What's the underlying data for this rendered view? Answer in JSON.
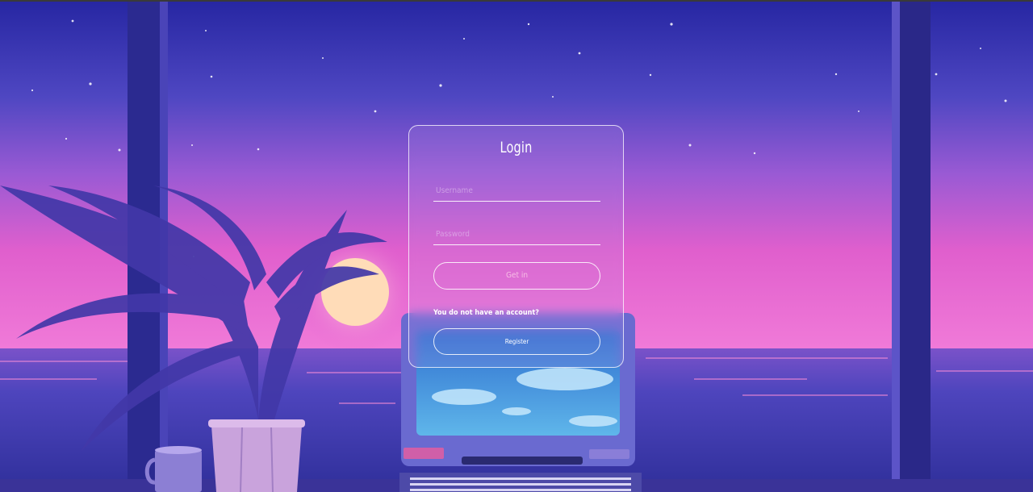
{
  "login": {
    "title": "Login",
    "username_placeholder": "Username",
    "password_placeholder": "Password",
    "get_in_label": "Get in",
    "no_account_text": "You do not have an account?",
    "register_label": "Register"
  },
  "colors": {
    "sky_top": "#2a2a9e",
    "sky_mid": "#8a4fd0",
    "sky_horizon": "#e45fcf",
    "sea": "#4a3fb8",
    "frame": "#2c2a8f",
    "sun": "#ffd9b0",
    "card_border": "#ffffff"
  },
  "icons": {
    "background": "sunset-window-scene"
  }
}
